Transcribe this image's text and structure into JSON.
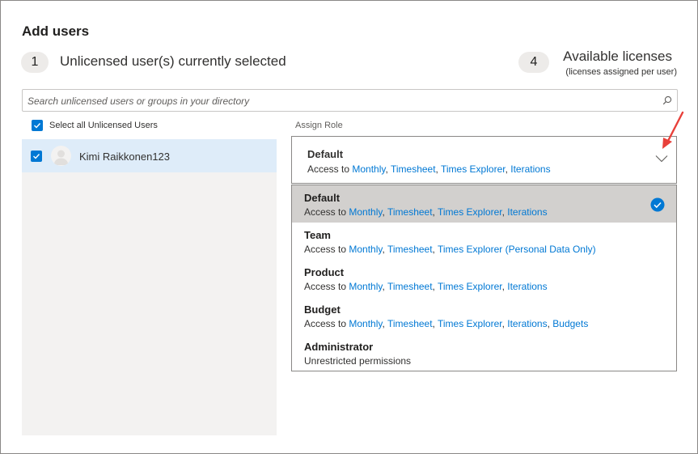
{
  "title": "Add users",
  "selected": {
    "count": "1",
    "label": "Unlicensed user(s) currently selected"
  },
  "licenses": {
    "count": "4",
    "label": "Available licenses",
    "sublabel": "(licenses assigned per user)"
  },
  "search": {
    "placeholder": "Search unlicensed users or groups in your directory",
    "value": ""
  },
  "select_all": {
    "label": "Select all Unlicensed Users",
    "checked": true
  },
  "users": [
    {
      "name": "Kimi Raikkonen123",
      "checked": true
    }
  ],
  "assign_role": {
    "label": "Assign Role",
    "current": {
      "name": "Default",
      "prefix": "Access to",
      "items": [
        "Monthly",
        "Timesheet",
        "Times Explorer",
        "Iterations"
      ]
    },
    "options": [
      {
        "name": "Default",
        "prefix": "Access to",
        "items": [
          "Monthly",
          "Timesheet",
          "Times Explorer",
          "Iterations"
        ],
        "selected": true
      },
      {
        "name": "Team",
        "prefix": "Access to",
        "items": [
          "Monthly",
          "Timesheet",
          "Times Explorer (Personal Data Only)"
        ],
        "selected": false
      },
      {
        "name": "Product",
        "prefix": "Access to",
        "items": [
          "Monthly",
          "Timesheet",
          "Times Explorer",
          "Iterations"
        ],
        "selected": false
      },
      {
        "name": "Budget",
        "prefix": "Access to",
        "items": [
          "Monthly",
          "Timesheet",
          "Times Explorer",
          "Iterations",
          "Budgets"
        ],
        "selected": false
      },
      {
        "name": "Administrator",
        "prefix": "Unrestricted permissions",
        "items": [],
        "selected": false
      }
    ]
  },
  "colors": {
    "accent": "#0078d4",
    "selected_row": "#deecf9",
    "selected_option": "#d2d0ce",
    "annotation_arrow": "#e8403a"
  },
  "icons": {
    "search": "search-icon",
    "dropdown": "chevron-down-icon",
    "selected": "checkmark-circle-icon",
    "avatar": "person-icon"
  }
}
